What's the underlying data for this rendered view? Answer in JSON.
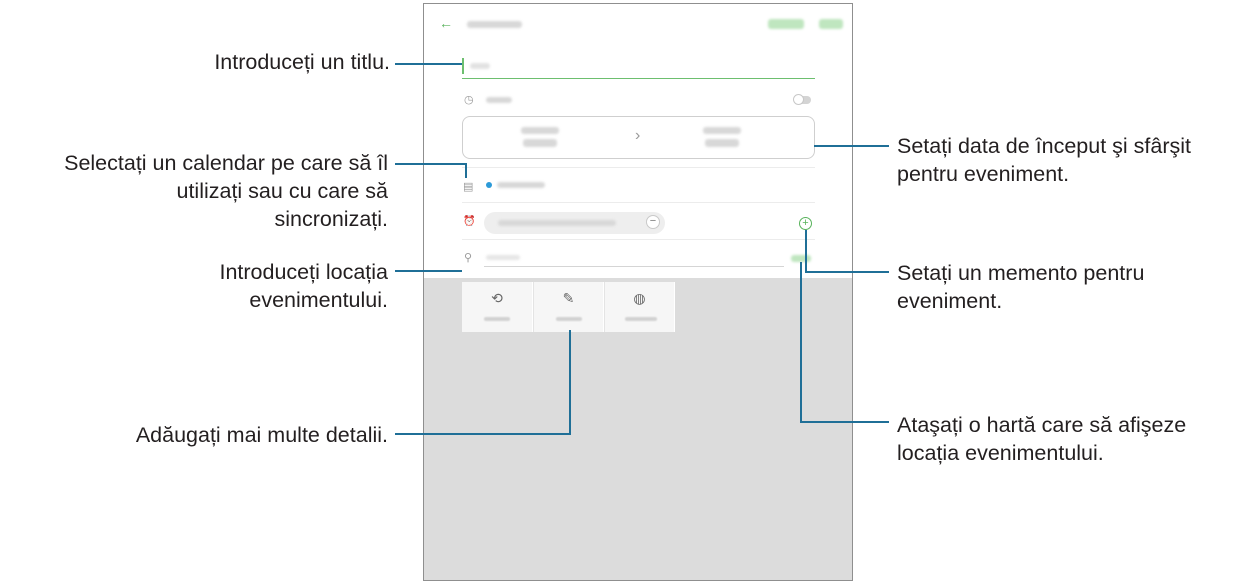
{
  "annotations": {
    "title": "Introduceți un titlu.",
    "calendar_line1": "Selectați un calendar pe care să îl",
    "calendar_line2": "utilizați sau cu care să",
    "calendar_line3": "sincronizați.",
    "location_line1": "Introduceți locația",
    "location_line2": "evenimentului.",
    "details": "Adăugați mai multe detalii.",
    "dates_line1": "Setați data de început şi sfârşit",
    "dates_line2": "pentru eveniment.",
    "reminder_line1": "Setați un memento pentru",
    "reminder_line2": "eveniment.",
    "map_line1": "Ataşați o hartă care să afişeze",
    "map_line2": "locația evenimentului."
  },
  "app": {
    "back_icon": "←",
    "date_arrow": "›",
    "clock_icon": "◷",
    "calendar_icon": "▤",
    "alarm_icon": "⏰",
    "pin_icon": "⚲",
    "minus": "−",
    "plus": "+",
    "repeat_icon": "⟲",
    "memo_icon": "✎",
    "timezone_icon": "◍"
  },
  "colors": {
    "callout_line": "#1f6f97",
    "accent": "#59b35c"
  }
}
